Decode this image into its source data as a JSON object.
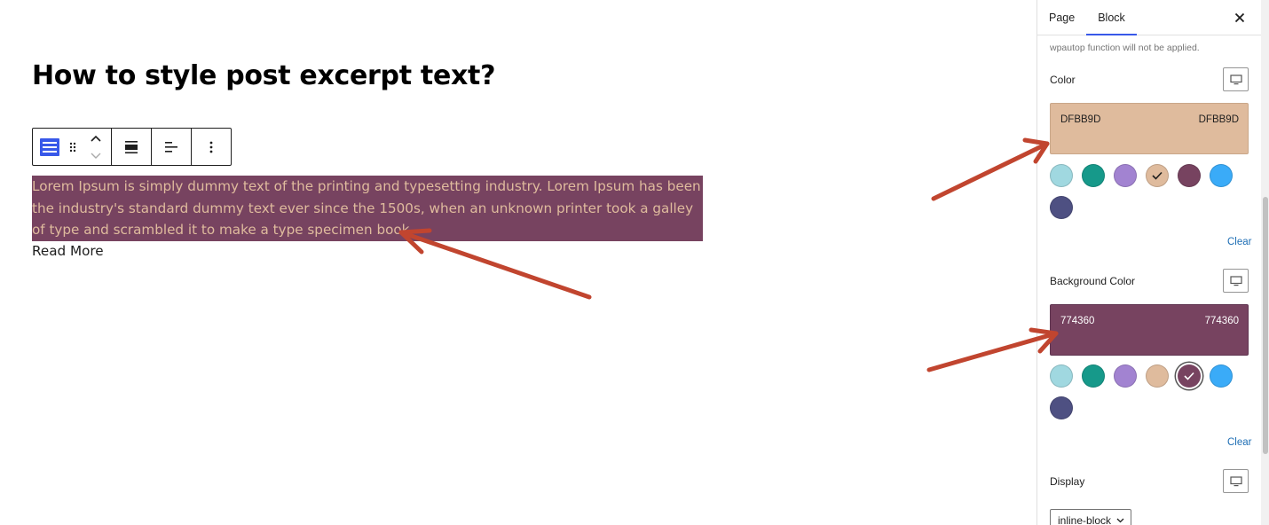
{
  "editor": {
    "post_title": "How to style post excerpt text?",
    "excerpt_text": "Lorem Ipsum is simply dummy text of the printing and typesetting industry. Lorem Ipsum has been the industry's standard dummy text ever since the 1500s, when an unknown printer took a galley of type and scrambled it to make a type specimen book",
    "read_more": "Read More",
    "excerpt_text_color": "#DFBB9D",
    "excerpt_background_color": "#774360"
  },
  "toolbar": {
    "icons": [
      "excerpt-block-icon",
      "drag-handle-icon",
      "move-up-icon",
      "move-down-icon",
      "align-wide-icon",
      "justify-left-icon",
      "more-options-icon"
    ]
  },
  "sidebar": {
    "tabs": [
      {
        "label": "Page",
        "active": false
      },
      {
        "label": "Block",
        "active": true
      }
    ],
    "help_text": "wpautop function will not be applied.",
    "color": {
      "label": "Color",
      "value_left": "DFBB9D",
      "value_right": "DFBB9D",
      "swatch": "#DFBB9D",
      "clear_label": "Clear"
    },
    "background_color": {
      "label": "Background Color",
      "value_left": "774360",
      "value_right": "774360",
      "swatch": "#774360",
      "clear_label": "Clear"
    },
    "palette": [
      "#A0D8E0",
      "#16998A",
      "#A283D1",
      "#DFBB9D",
      "#774360",
      "#3AABF8",
      "#4E5082"
    ],
    "display": {
      "label": "Display",
      "selected_value": "inline-block"
    },
    "accent_color": "#3858e9",
    "annotation_arrow_color": "#C1452F"
  }
}
